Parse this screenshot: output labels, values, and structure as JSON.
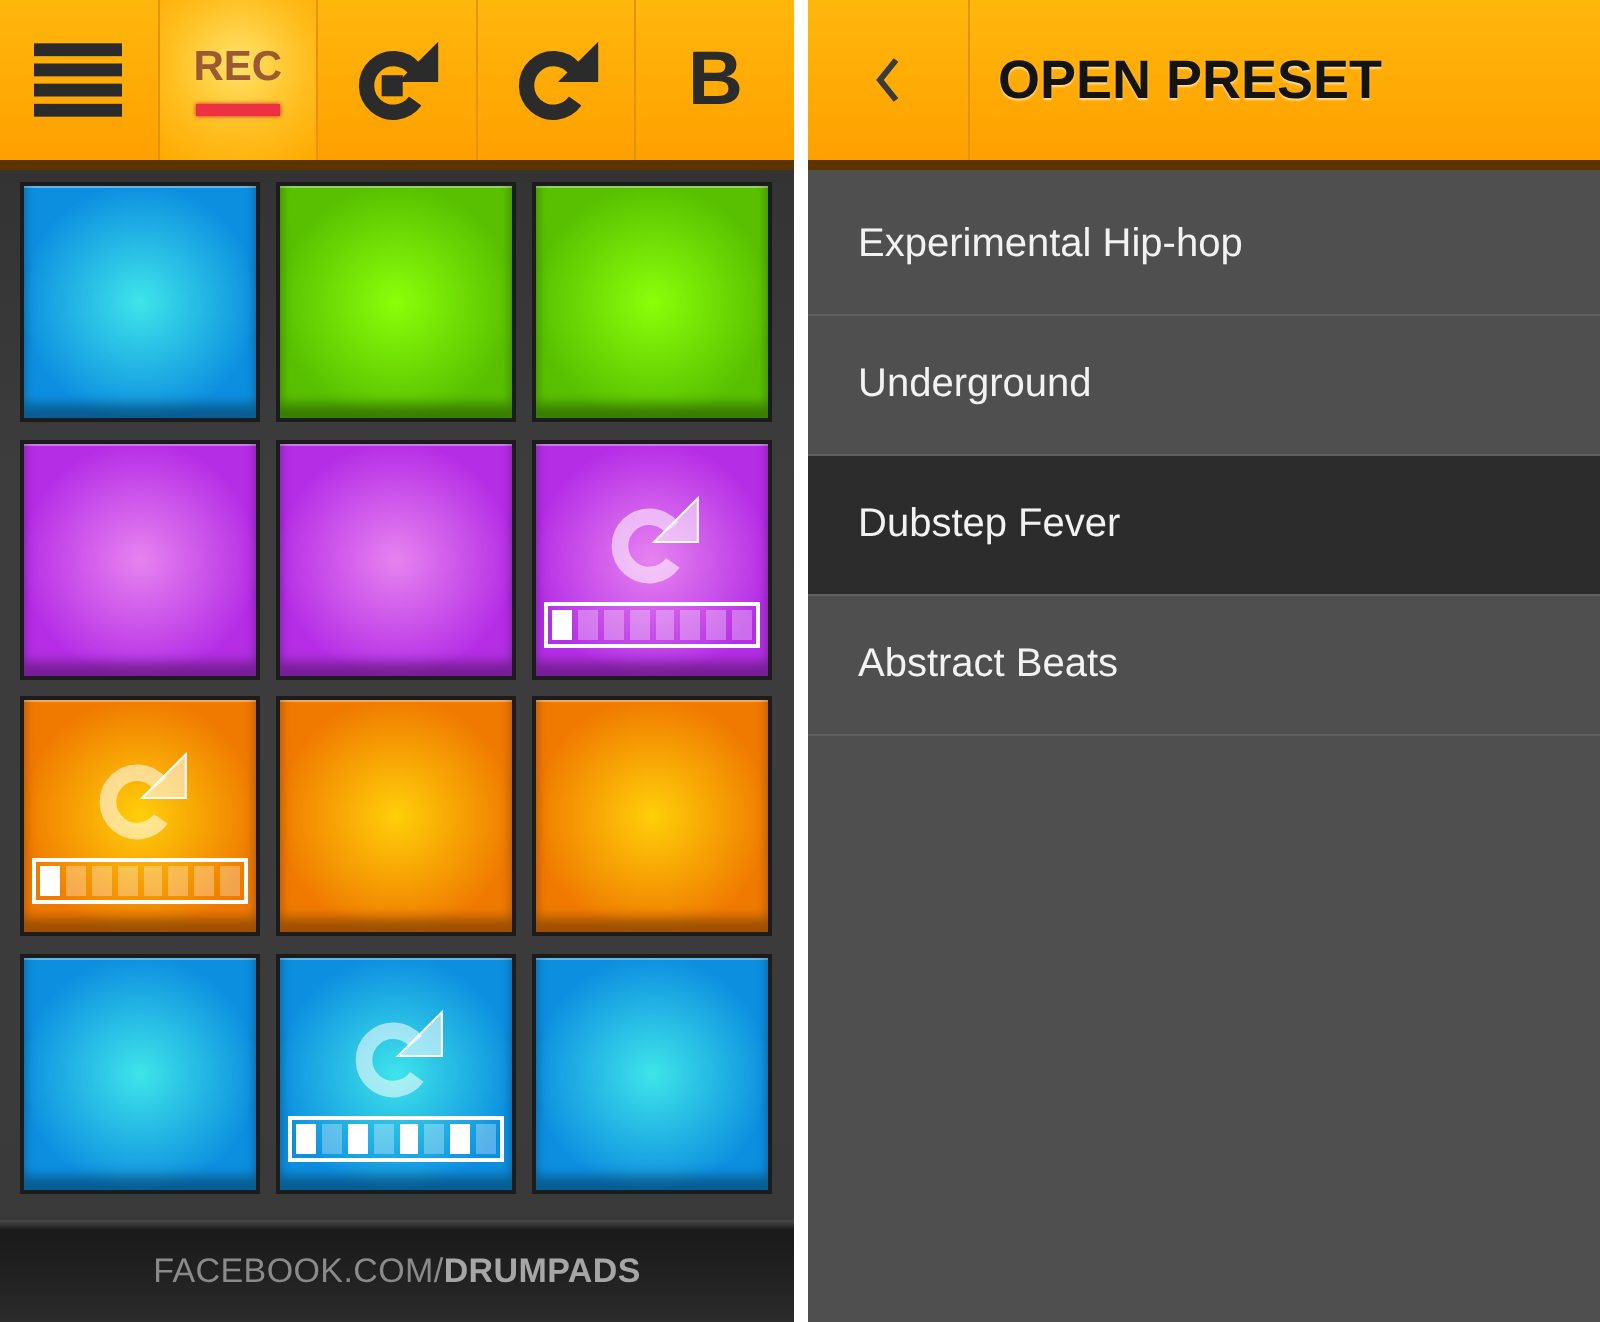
{
  "toolbar": {
    "buttons": [
      {
        "kind": "menu",
        "active": false
      },
      {
        "kind": "rec",
        "label": "REC",
        "active": true
      },
      {
        "kind": "loop-stop",
        "active": false
      },
      {
        "kind": "redo",
        "active": false
      },
      {
        "kind": "text",
        "label": "B",
        "active": false
      }
    ]
  },
  "pads": [
    {
      "kind": "plain",
      "color": "#0d8fe0"
    },
    {
      "kind": "plain",
      "color": "#58c000"
    },
    {
      "kind": "plain",
      "color": "#58c000"
    },
    {
      "kind": "plain",
      "color": "#b52ee6"
    },
    {
      "kind": "plain",
      "color": "#b52ee6"
    },
    {
      "kind": "loop",
      "color": "#b52ee6",
      "steps": [
        {
          "on": true
        },
        {
          "on": false
        },
        {
          "on": false
        },
        {
          "on": false
        },
        {
          "on": false
        },
        {
          "on": false
        },
        {
          "on": false
        },
        {
          "on": false
        }
      ]
    },
    {
      "kind": "loop",
      "color": "#f07a00",
      "steps": [
        {
          "on": true
        },
        {
          "on": false
        },
        {
          "on": false
        },
        {
          "on": false
        },
        {
          "on": false
        },
        {
          "on": false
        },
        {
          "on": false
        },
        {
          "on": false
        }
      ]
    },
    {
      "kind": "plain",
      "color": "#f07a00"
    },
    {
      "kind": "plain",
      "color": "#f07a00"
    },
    {
      "kind": "plain",
      "color": "#0d8fe0"
    },
    {
      "kind": "loop",
      "color": "#0d8fe0",
      "steps": [
        {
          "on": true
        },
        {
          "on": false
        },
        {
          "on": true
        },
        {
          "on": false
        },
        {
          "on": true
        },
        {
          "on": false
        },
        {
          "on": true
        },
        {
          "on": false
        }
      ]
    },
    {
      "kind": "plain",
      "color": "#0d8fe0"
    }
  ],
  "footer": {
    "text": "FACEBOOK.COM/**DRUMPADS**"
  },
  "preset_panel": {
    "title": "OPEN PRESET",
    "items": [
      {
        "label": "Experimental Hip-hop",
        "selected": false
      },
      {
        "label": "Underground",
        "selected": false
      },
      {
        "label": "Dubstep Fever",
        "selected": true
      },
      {
        "label": "Abstract Beats",
        "selected": false
      }
    ]
  }
}
